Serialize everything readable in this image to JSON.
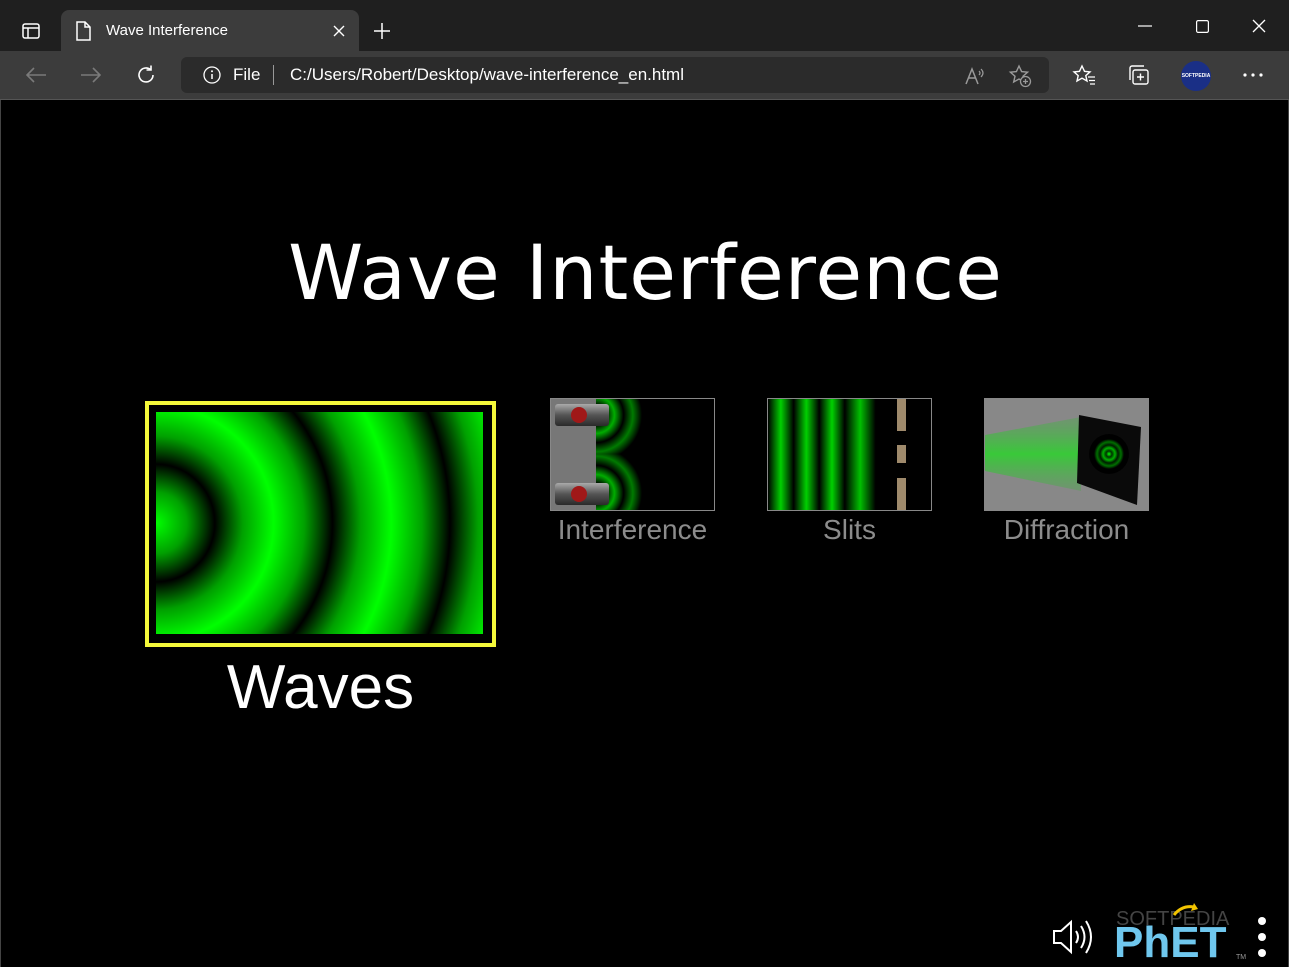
{
  "browser": {
    "tab_title": "Wave Interference",
    "address_scheme": "File",
    "address_url": "C:/Users/Robert/Desktop/wave-interference_en.html",
    "profile_label": "SOFTPEDIA",
    "icons": [
      "tab-actions-icon",
      "page-icon",
      "close-icon",
      "plus-icon",
      "minimize-icon",
      "maximize-icon",
      "window-close-icon",
      "back-icon",
      "forward-icon",
      "refresh-icon",
      "info-icon",
      "read-aloud-icon",
      "add-favorite-icon",
      "favorites-icon",
      "collections-icon",
      "more-icon"
    ]
  },
  "sim": {
    "title": "Wave Interference",
    "screens": [
      {
        "label": "Waves",
        "selected": true
      },
      {
        "label": "Interference",
        "selected": false
      },
      {
        "label": "Slits",
        "selected": false
      },
      {
        "label": "Diffraction",
        "selected": false
      }
    ],
    "logo_text": "PhET",
    "watermark": "SOFTPEDIA",
    "colors": {
      "wave_green": "#00ff00",
      "selected_border": "#f4f83a",
      "inactive_label": "#8c8c8c"
    }
  }
}
